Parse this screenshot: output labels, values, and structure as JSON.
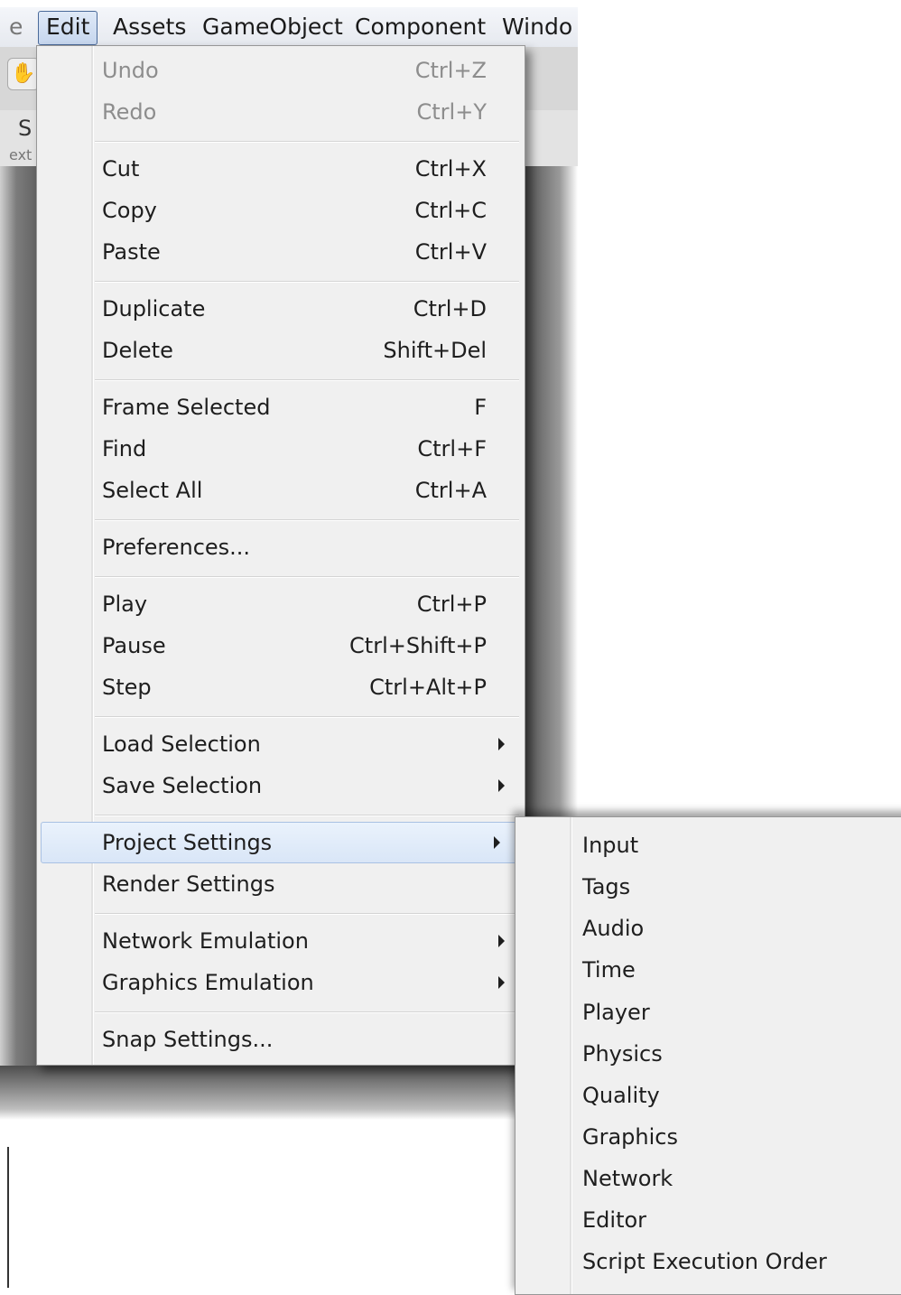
{
  "menubar": {
    "items": [
      "e",
      "Edit",
      "Assets",
      "GameObject",
      "Component",
      "Windo"
    ]
  },
  "background": {
    "panel_letter": "S",
    "panel_text": "ext"
  },
  "edit_menu": {
    "items": [
      {
        "label": "Undo",
        "shortcut": "Ctrl+Z"
      },
      {
        "label": "Redo",
        "shortcut": "Ctrl+Y"
      },
      {
        "label": "Cut",
        "shortcut": "Ctrl+X"
      },
      {
        "label": "Copy",
        "shortcut": "Ctrl+C"
      },
      {
        "label": "Paste",
        "shortcut": "Ctrl+V"
      },
      {
        "label": "Duplicate",
        "shortcut": "Ctrl+D"
      },
      {
        "label": "Delete",
        "shortcut": "Shift+Del"
      },
      {
        "label": "Frame Selected",
        "shortcut": "F"
      },
      {
        "label": "Find",
        "shortcut": "Ctrl+F"
      },
      {
        "label": "Select All",
        "shortcut": "Ctrl+A"
      },
      {
        "label": "Preferences...",
        "shortcut": ""
      },
      {
        "label": "Play",
        "shortcut": "Ctrl+P"
      },
      {
        "label": "Pause",
        "shortcut": "Ctrl+Shift+P"
      },
      {
        "label": "Step",
        "shortcut": "Ctrl+Alt+P"
      },
      {
        "label": "Load Selection",
        "shortcut": ""
      },
      {
        "label": "Save Selection",
        "shortcut": ""
      },
      {
        "label": "Project Settings",
        "shortcut": ""
      },
      {
        "label": "Render Settings",
        "shortcut": ""
      },
      {
        "label": "Network Emulation",
        "shortcut": ""
      },
      {
        "label": "Graphics Emulation",
        "shortcut": ""
      },
      {
        "label": "Snap Settings...",
        "shortcut": ""
      }
    ]
  },
  "project_settings_submenu": {
    "items": [
      "Input",
      "Tags",
      "Audio",
      "Time",
      "Player",
      "Physics",
      "Quality",
      "Graphics",
      "Network",
      "Editor",
      "Script Execution Order"
    ]
  },
  "icons": {
    "hand": "hand-tool-icon",
    "submenu_arrow": "chevron-right-icon"
  },
  "colors": {
    "menu_bg": "#f0f0f0",
    "highlight_bg": "#d9e6f7",
    "highlight_border": "#a9c1e3",
    "disabled_text": "#8d8d8d"
  }
}
